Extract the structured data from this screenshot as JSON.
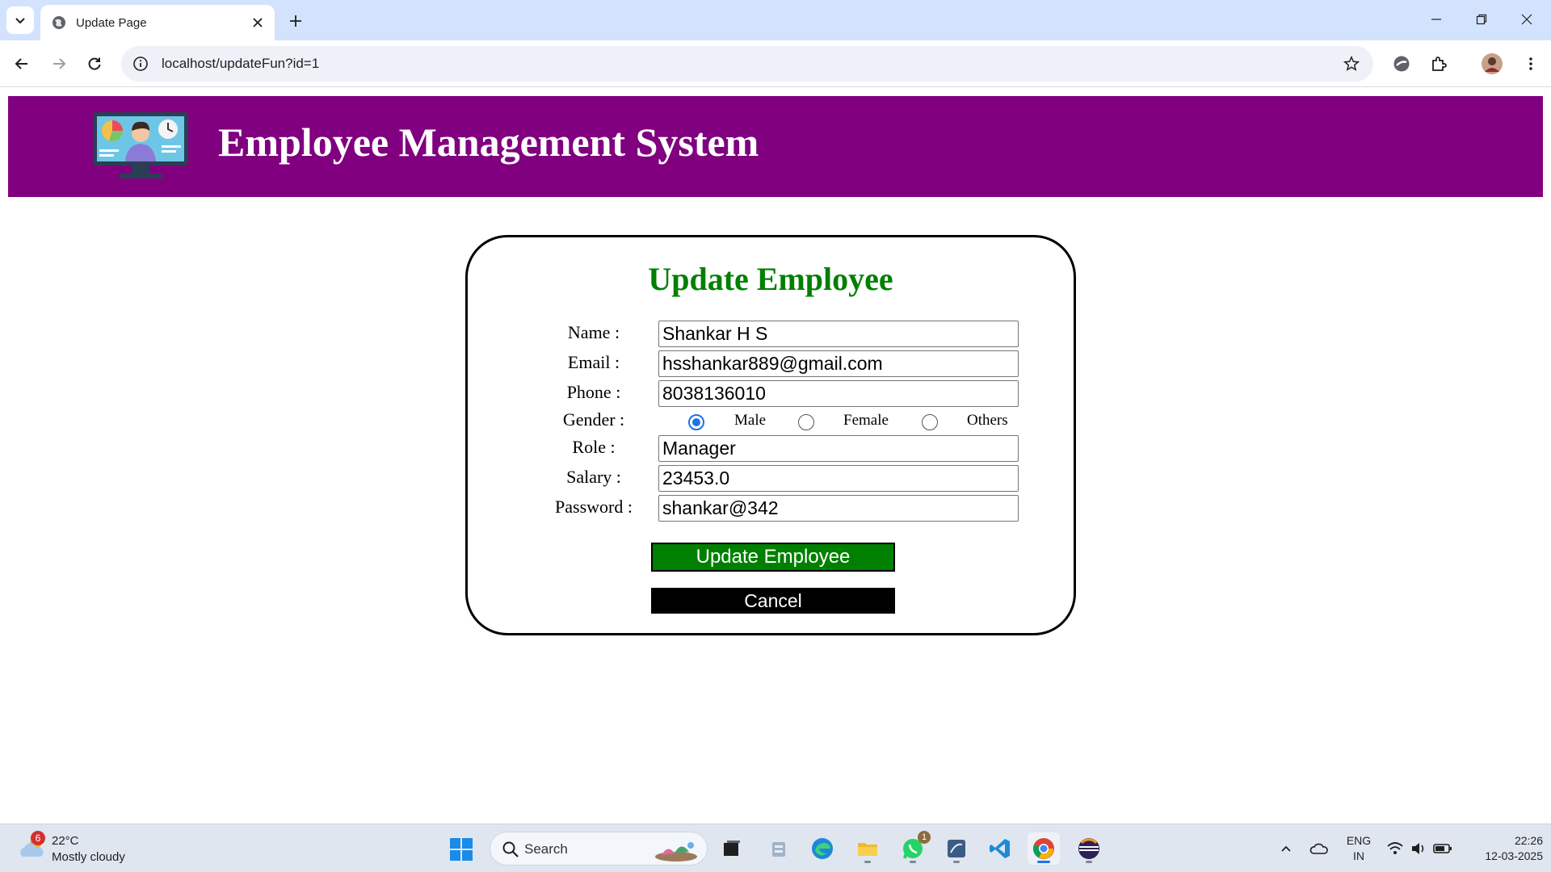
{
  "browser": {
    "tab_title": "Update Page",
    "url": "localhost/updateFun?id=1"
  },
  "header": {
    "title": "Employee Management System"
  },
  "form": {
    "title": "Update Employee",
    "fields": {
      "name": {
        "label": "Name :",
        "value": "Shankar H S"
      },
      "email": {
        "label": "Email :",
        "value": "hsshankar889@gmail.com"
      },
      "phone": {
        "label": "Phone :",
        "value": "8038136010"
      },
      "role": {
        "label": "Role :",
        "value": "Manager"
      },
      "salary": {
        "label": "Salary :",
        "value": "23453.0"
      },
      "password": {
        "label": "Password :",
        "value": "shankar@342"
      }
    },
    "gender": {
      "label": "Gender :",
      "options": [
        "Male",
        "Female",
        "Others"
      ],
      "selected": "Male"
    },
    "update_button": "Update Employee",
    "cancel_button": "Cancel"
  },
  "colors": {
    "header_bg": "#800080",
    "title_green": "#008000",
    "update_bg": "#008000",
    "cancel_bg": "#000000"
  },
  "taskbar": {
    "weather_badge": "6",
    "weather_temp": "22°C",
    "weather_condition": "Mostly cloudy",
    "search_placeholder": "Search",
    "whatsapp_badge": "1",
    "language_line1": "ENG",
    "language_line2": "IN",
    "time": "22:26",
    "date": "12-03-2025"
  }
}
